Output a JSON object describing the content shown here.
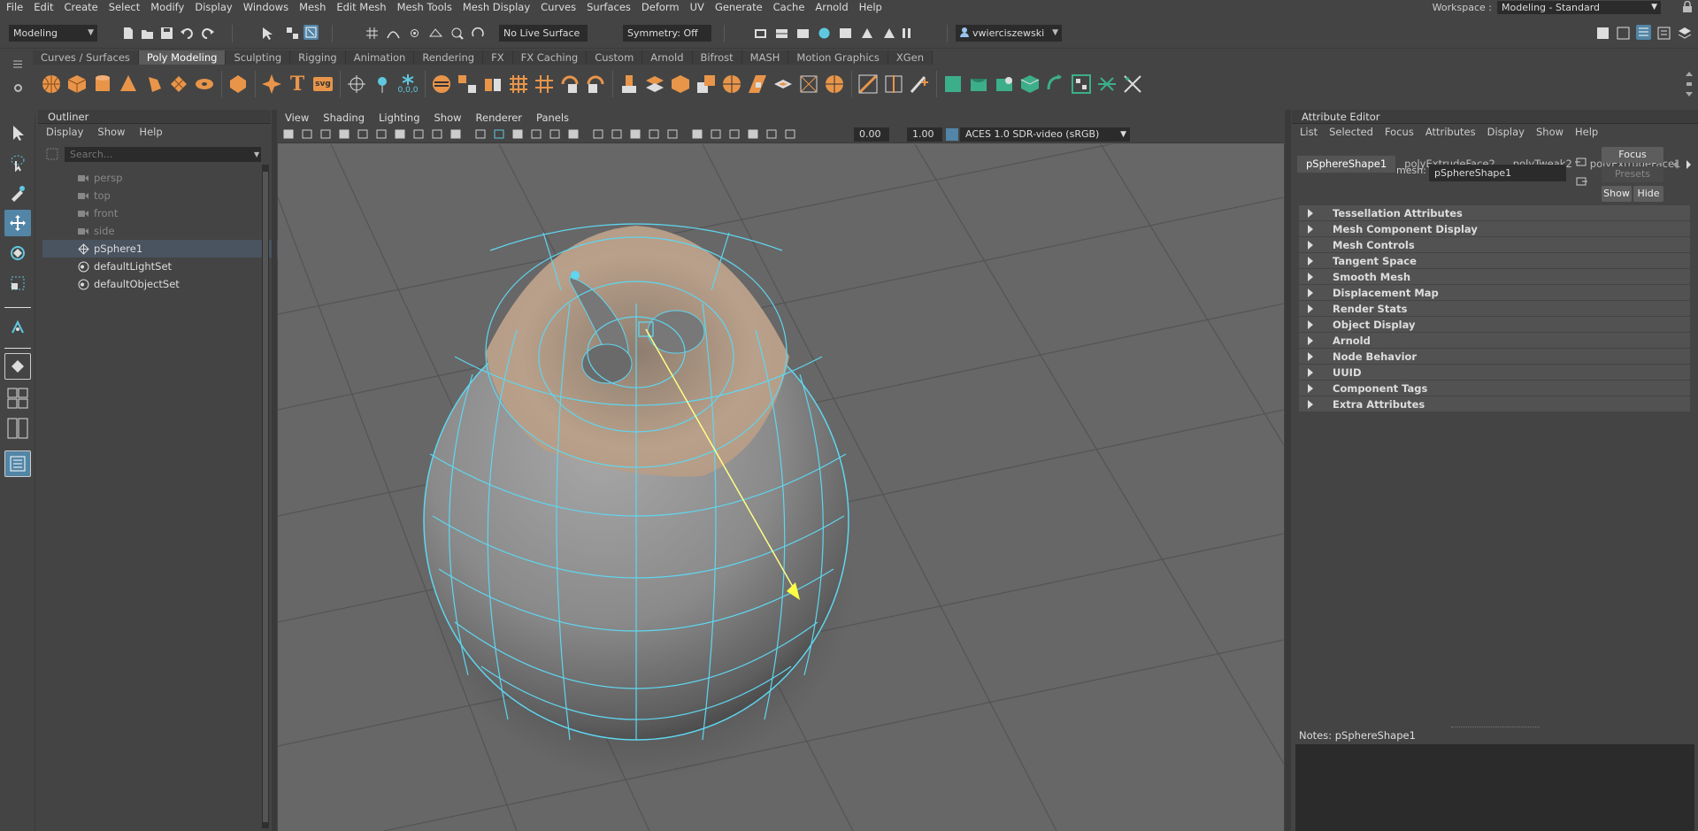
{
  "menubar": {
    "items": [
      "File",
      "Edit",
      "Create",
      "Select",
      "Modify",
      "Display",
      "Windows",
      "Mesh",
      "Edit Mesh",
      "Mesh Tools",
      "Mesh Display",
      "Curves",
      "Surfaces",
      "Deform",
      "UV",
      "Generate",
      "Cache",
      "Arnold",
      "Help"
    ]
  },
  "workspace": {
    "label": "Workspace :",
    "value": "Modeling - Standard"
  },
  "status": {
    "mode": "Modeling",
    "live_surface": "No Live Surface",
    "symmetry": "Symmetry: Off",
    "user": "vwierciszewski"
  },
  "shelf": {
    "tabs": [
      "Curves / Surfaces",
      "Poly Modeling",
      "Sculpting",
      "Rigging",
      "Animation",
      "Rendering",
      "FX",
      "FX Caching",
      "Custom",
      "Arnold",
      "Bifrost",
      "MASH",
      "Motion Graphics",
      "XGen"
    ],
    "active": "Poly Modeling",
    "svg_label": "svg",
    "text_label": "T",
    "coord_label": "0,0,0"
  },
  "outliner": {
    "title": "Outliner",
    "menu": [
      "Display",
      "Show",
      "Help"
    ],
    "search_placeholder": "Search...",
    "items": [
      {
        "label": "persp",
        "icon": "camera-icon",
        "dim": true
      },
      {
        "label": "top",
        "icon": "camera-icon",
        "dim": true
      },
      {
        "label": "front",
        "icon": "camera-icon",
        "dim": true
      },
      {
        "label": "side",
        "icon": "camera-icon",
        "dim": true
      },
      {
        "label": "pSphere1",
        "icon": "mesh-transform-icon",
        "dim": false,
        "selected": true
      },
      {
        "label": "defaultLightSet",
        "icon": "set-icon",
        "dim": false
      },
      {
        "label": "defaultObjectSet",
        "icon": "set-icon",
        "dim": false
      }
    ]
  },
  "viewport": {
    "menu": [
      "View",
      "Shading",
      "Lighting",
      "Show",
      "Renderer",
      "Panels"
    ],
    "exposure": "0.00",
    "gamma": "1.00",
    "color_space": "ACES 1.0 SDR-video (sRGB)"
  },
  "attribute_editor": {
    "title": "Attribute Editor",
    "menu": [
      "List",
      "Selected",
      "Focus",
      "Attributes",
      "Display",
      "Show",
      "Help"
    ],
    "tabs": [
      "pSphereShape1",
      "polyExtrudeFace2",
      "polyTweak2",
      "polyExtrudeFace1"
    ],
    "active_tab": "pSphereShape1",
    "mesh_label": "mesh:",
    "mesh_value": "pSphereShape1",
    "focus_btn": "Focus",
    "presets_btn": "Presets",
    "show_btn": "Show",
    "hide_btn": "Hide",
    "sections": [
      "Tessellation Attributes",
      "Mesh Component Display",
      "Mesh Controls",
      "Tangent Space",
      "Smooth Mesh",
      "Displacement Map",
      "Render Stats",
      "Object Display",
      "Arnold",
      "Node Behavior",
      "UUID",
      "Component Tags",
      "Extra Attributes"
    ],
    "notes_label": "Notes:  pSphereShape1"
  },
  "colors": {
    "accent": "#5285a6",
    "wire": "#5fd6f0",
    "shelf_icon": "#e8954a",
    "manip": "#ffff88"
  }
}
